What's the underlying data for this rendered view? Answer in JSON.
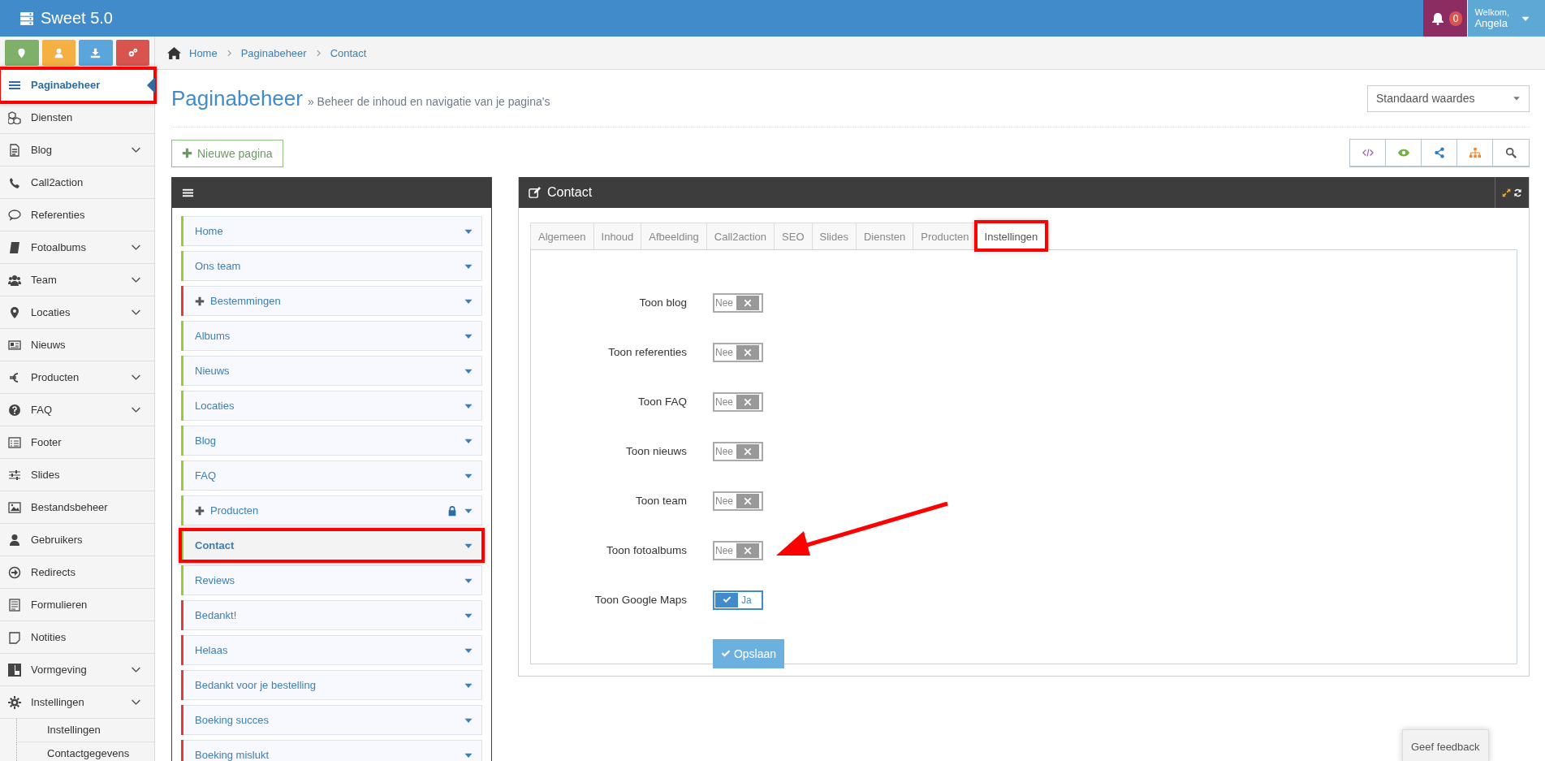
{
  "app": {
    "title": "Sweet 5.0"
  },
  "header": {
    "notification_count": "0",
    "greeting": "Welkom,",
    "user": "Angela"
  },
  "sidebar": {
    "items": [
      {
        "label": "Paginabeheer",
        "selected": true,
        "expandable": false,
        "annotated": true
      },
      {
        "label": "Diensten",
        "selected": false,
        "expandable": false,
        "annotated": false
      },
      {
        "label": "Blog",
        "selected": false,
        "expandable": true,
        "annotated": false
      },
      {
        "label": "Call2action",
        "selected": false,
        "expandable": false,
        "annotated": false
      },
      {
        "label": "Referenties",
        "selected": false,
        "expandable": false,
        "annotated": false
      },
      {
        "label": "Fotoalbums",
        "selected": false,
        "expandable": true,
        "annotated": false
      },
      {
        "label": "Team",
        "selected": false,
        "expandable": true,
        "annotated": false
      },
      {
        "label": "Locaties",
        "selected": false,
        "expandable": true,
        "annotated": false
      },
      {
        "label": "Nieuws",
        "selected": false,
        "expandable": false,
        "annotated": false
      },
      {
        "label": "Producten",
        "selected": false,
        "expandable": true,
        "annotated": false
      },
      {
        "label": "FAQ",
        "selected": false,
        "expandable": true,
        "annotated": false
      },
      {
        "label": "Footer",
        "selected": false,
        "expandable": false,
        "annotated": false
      },
      {
        "label": "Slides",
        "selected": false,
        "expandable": false,
        "annotated": false
      },
      {
        "label": "Bestandsbeheer",
        "selected": false,
        "expandable": false,
        "annotated": false
      },
      {
        "label": "Gebruikers",
        "selected": false,
        "expandable": false,
        "annotated": false
      },
      {
        "label": "Redirects",
        "selected": false,
        "expandable": false,
        "annotated": false
      },
      {
        "label": "Formulieren",
        "selected": false,
        "expandable": false,
        "annotated": false
      },
      {
        "label": "Notities",
        "selected": false,
        "expandable": false,
        "annotated": false
      },
      {
        "label": "Vormgeving",
        "selected": false,
        "expandable": true,
        "annotated": false
      },
      {
        "label": "Instellingen",
        "selected": false,
        "expandable": true,
        "annotated": false,
        "children": [
          {
            "label": "Instellingen",
            "selected": false
          },
          {
            "label": "Contactgegevens",
            "selected": false
          }
        ]
      }
    ]
  },
  "breadcrumb": [
    "Home",
    "Paginabeheer",
    "Contact"
  ],
  "page": {
    "title": "Paginabeheer",
    "subtitle": "» Beheer de inhoud en navigatie van je pagina's",
    "preset_select": {
      "value": "Standaard waardes"
    },
    "new_page_button": "Nieuwe pagina"
  },
  "tree": {
    "items": [
      {
        "label": "Home",
        "color": "#99cc33",
        "expandable": false,
        "locked": false,
        "selected": false,
        "annotated": false
      },
      {
        "label": "Ons team",
        "color": "#99cc33",
        "expandable": false,
        "locked": false,
        "selected": false,
        "annotated": false
      },
      {
        "label": "Bestemmingen",
        "color": "#e03c3c",
        "expandable": true,
        "locked": false,
        "selected": false,
        "annotated": false
      },
      {
        "label": "Albums",
        "color": "#99cc33",
        "expandable": false,
        "locked": false,
        "selected": false,
        "annotated": false
      },
      {
        "label": "Nieuws",
        "color": "#99cc33",
        "expandable": false,
        "locked": false,
        "selected": false,
        "annotated": false
      },
      {
        "label": "Locaties",
        "color": "#99cc33",
        "expandable": false,
        "locked": false,
        "selected": false,
        "annotated": false
      },
      {
        "label": "Blog",
        "color": "#99cc33",
        "expandable": false,
        "locked": false,
        "selected": false,
        "annotated": false
      },
      {
        "label": "FAQ",
        "color": "#99cc33",
        "expandable": false,
        "locked": false,
        "selected": false,
        "annotated": false
      },
      {
        "label": "Producten",
        "color": "#99cc33",
        "expandable": true,
        "locked": true,
        "selected": false,
        "annotated": false
      },
      {
        "label": "Contact",
        "color": "#99cc33",
        "expandable": false,
        "locked": false,
        "selected": true,
        "annotated": true
      },
      {
        "label": "Reviews",
        "color": "#99cc33",
        "expandable": false,
        "locked": false,
        "selected": false,
        "annotated": false
      },
      {
        "label": "Bedankt!",
        "color": "#e03c3c",
        "expandable": false,
        "locked": false,
        "selected": false,
        "annotated": false
      },
      {
        "label": "Helaas",
        "color": "#e03c3c",
        "expandable": false,
        "locked": false,
        "selected": false,
        "annotated": false
      },
      {
        "label": "Bedankt voor je bestelling",
        "color": "#e03c3c",
        "expandable": false,
        "locked": false,
        "selected": false,
        "annotated": false
      },
      {
        "label": "Boeking succes",
        "color": "#e03c3c",
        "expandable": false,
        "locked": false,
        "selected": false,
        "annotated": false
      },
      {
        "label": "Boeking mislukt",
        "color": "#e03c3c",
        "expandable": false,
        "locked": false,
        "selected": false,
        "annotated": false
      }
    ]
  },
  "editor": {
    "title": "Contact",
    "tabs": [
      {
        "label": "Algemeen",
        "selected": false,
        "annotated": false
      },
      {
        "label": "Inhoud",
        "selected": false,
        "annotated": false
      },
      {
        "label": "Afbeelding",
        "selected": false,
        "annotated": false
      },
      {
        "label": "Call2action",
        "selected": false,
        "annotated": false
      },
      {
        "label": "SEO",
        "selected": false,
        "annotated": false
      },
      {
        "label": "Slides",
        "selected": false,
        "annotated": false
      },
      {
        "label": "Diensten",
        "selected": false,
        "annotated": false
      },
      {
        "label": "Producten",
        "selected": false,
        "annotated": false
      },
      {
        "label": "Instellingen",
        "selected": true,
        "annotated": true
      }
    ],
    "settings": [
      {
        "label": "Toon blog",
        "on": false,
        "state_text": "Nee"
      },
      {
        "label": "Toon referenties",
        "on": false,
        "state_text": "Nee"
      },
      {
        "label": "Toon FAQ",
        "on": false,
        "state_text": "Nee"
      },
      {
        "label": "Toon nieuws",
        "on": false,
        "state_text": "Nee"
      },
      {
        "label": "Toon team",
        "on": false,
        "state_text": "Nee"
      },
      {
        "label": "Toon fotoalbums",
        "on": false,
        "state_text": "Nee"
      },
      {
        "label": "Toon Google Maps",
        "on": true,
        "state_text": "Ja"
      }
    ],
    "save_button": "Opslaan"
  },
  "feedback_button": "Geef feedback"
}
